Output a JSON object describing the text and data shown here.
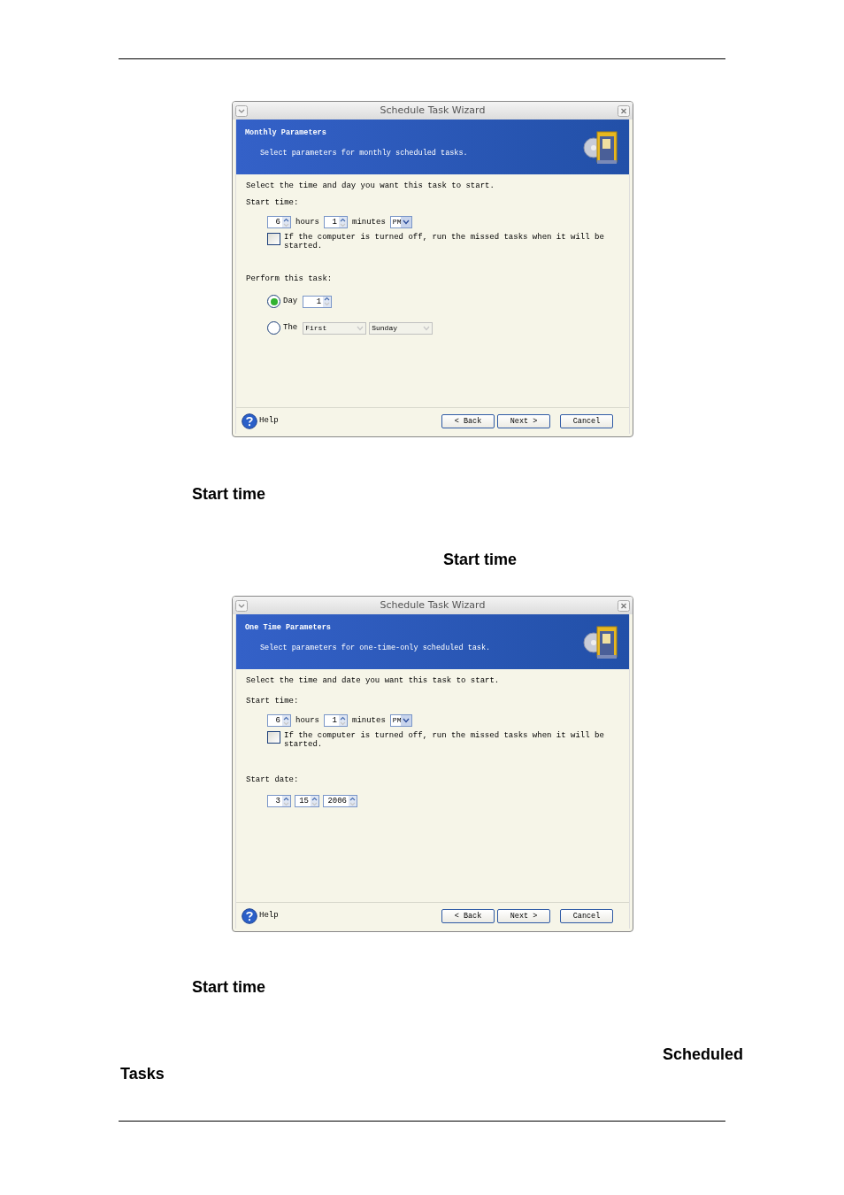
{
  "dialogs": [
    {
      "title": "Schedule Task Wizard",
      "header": {
        "title": "Monthly Parameters",
        "subtitle": "Select parameters for monthly scheduled tasks."
      },
      "prompt": "Select the time and day you want this task to start.",
      "start_time": {
        "label": "Start time:",
        "hours": "6",
        "hours_label": "hours",
        "minutes": "1",
        "minutes_label": "minutes",
        "ampm": "PM"
      },
      "checkbox": {
        "label": "If the computer is turned off, run the missed tasks when it will be started.",
        "checked": false
      },
      "section": {
        "kind": "perform",
        "label": "Perform this task:",
        "options": [
          {
            "kind": "day",
            "label": "Day",
            "value": "1",
            "selected": true
          },
          {
            "kind": "ordinal",
            "label": "The",
            "ordinal": "First",
            "weekday": "Sunday",
            "selected": false
          }
        ]
      },
      "buttons": {
        "help": "Help",
        "back": "< Back",
        "next": "Next >",
        "cancel": "Cancel"
      }
    },
    {
      "title": "Schedule Task Wizard",
      "header": {
        "title": "One Time Parameters",
        "subtitle": "Select parameters for one-time-only scheduled task."
      },
      "prompt": "Select the time and date you want this task to start.",
      "start_time": {
        "label": "Start time:",
        "hours": "6",
        "hours_label": "hours",
        "minutes": "1",
        "minutes_label": "minutes",
        "ampm": "PM"
      },
      "checkbox": {
        "label": "If the computer is turned off, run the missed tasks when it will be started.",
        "checked": false
      },
      "section": {
        "kind": "date",
        "label": "Start date:",
        "fields": [
          "3",
          "15",
          "2006"
        ]
      },
      "buttons": {
        "help": "Help",
        "back": "< Back",
        "next": "Next >",
        "cancel": "Cancel"
      }
    }
  ],
  "phrases": [
    "Start time",
    "Start time",
    "Start time",
    "Scheduled",
    "Tasks"
  ]
}
